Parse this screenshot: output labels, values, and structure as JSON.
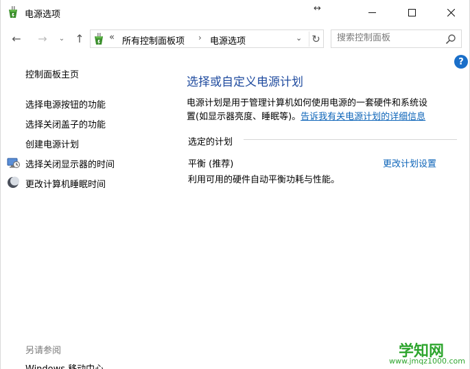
{
  "window": {
    "title": "电源选项",
    "resize_glyph": "↔",
    "controls": {
      "minimize": "minimize-icon",
      "maximize": "maximize-icon",
      "close": "close-icon"
    }
  },
  "navigation": {
    "back_glyph": "←",
    "forward_glyph": "→",
    "recent_glyph": "⌄",
    "up_glyph": "↑",
    "address": {
      "overflow": "«",
      "crumbs": [
        "所有控制面板项",
        "电源选项"
      ],
      "separator": "›",
      "dropdown_glyph": "⌄",
      "refresh_glyph": "↻"
    },
    "search": {
      "placeholder": "搜索控制面板"
    }
  },
  "help": {
    "glyph": "?"
  },
  "sidebar": {
    "home": "控制面板主页",
    "links": [
      "选择电源按钮的功能",
      "选择关闭盖子的功能",
      "创建电源计划",
      "选择关闭显示器的时间",
      "更改计算机睡眠时间"
    ],
    "see_also": "另请参阅",
    "see_also_links": [
      "Windows 移动中心"
    ]
  },
  "main": {
    "title": "选择或自定义电源计划",
    "description_line1": "电源计划是用于管理计算机如何使用电源的一套硬件和系统设",
    "description_line2": "置(如显示器亮度、睡眠等)。",
    "description_link": "告诉我有关电源计划的详细信息",
    "section_label": "选定的计划",
    "plan": {
      "name": "平衡 (推荐)",
      "settings_link": "更改计划设置",
      "description": "利用可用的硬件自动平衡功耗与性能。"
    }
  },
  "watermark": {
    "main": "学知网",
    "sub": "www.jmqz1000.com"
  },
  "colors": {
    "accent_title": "#1e4a9e",
    "link": "#0b63b8",
    "help": "#1a6fc9",
    "watermark": "#2ea52e"
  }
}
